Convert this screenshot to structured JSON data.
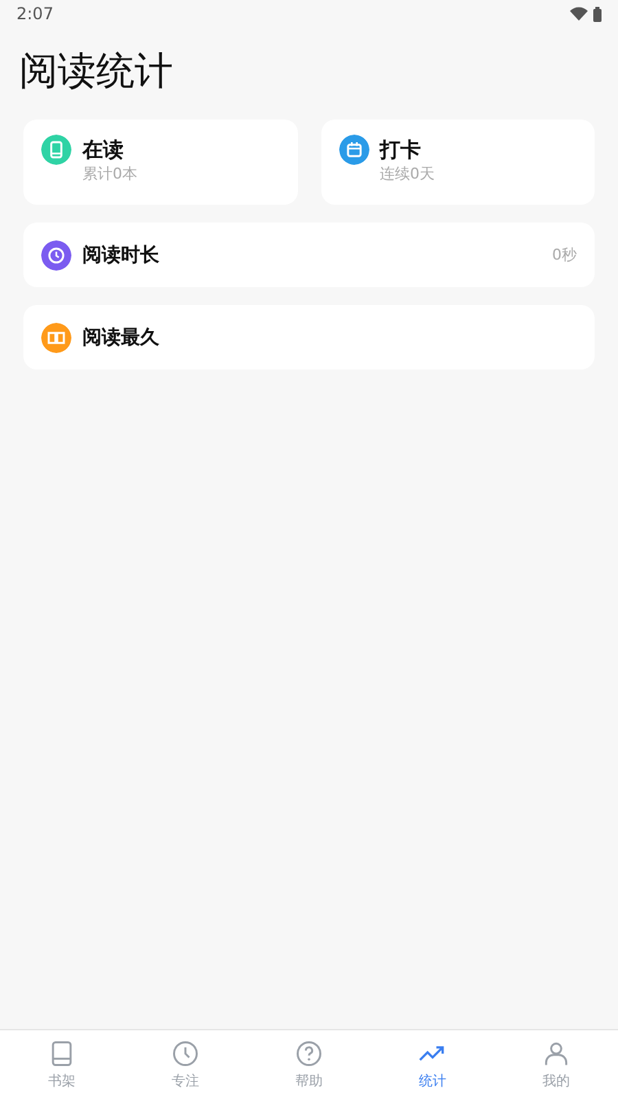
{
  "status_bar": {
    "time": "2:07"
  },
  "title": "阅读统计",
  "summary_cards": [
    {
      "title": "在读",
      "subtitle": "累计0本",
      "color": "#2fd3a5"
    },
    {
      "title": "打卡",
      "subtitle": "连续0天",
      "color": "#2a9be8"
    }
  ],
  "stat_rows": [
    {
      "title": "阅读时长",
      "value": "0秒",
      "color": "#7b5cf0"
    },
    {
      "title": "阅读最久",
      "color": "#ff9a1a"
    }
  ],
  "tab_bar": [
    {
      "label": "书架",
      "selected": false
    },
    {
      "label": "专注",
      "selected": false
    },
    {
      "label": "帮助",
      "selected": false
    },
    {
      "label": "统计",
      "selected": true
    },
    {
      "label": "我的",
      "selected": false
    }
  ]
}
